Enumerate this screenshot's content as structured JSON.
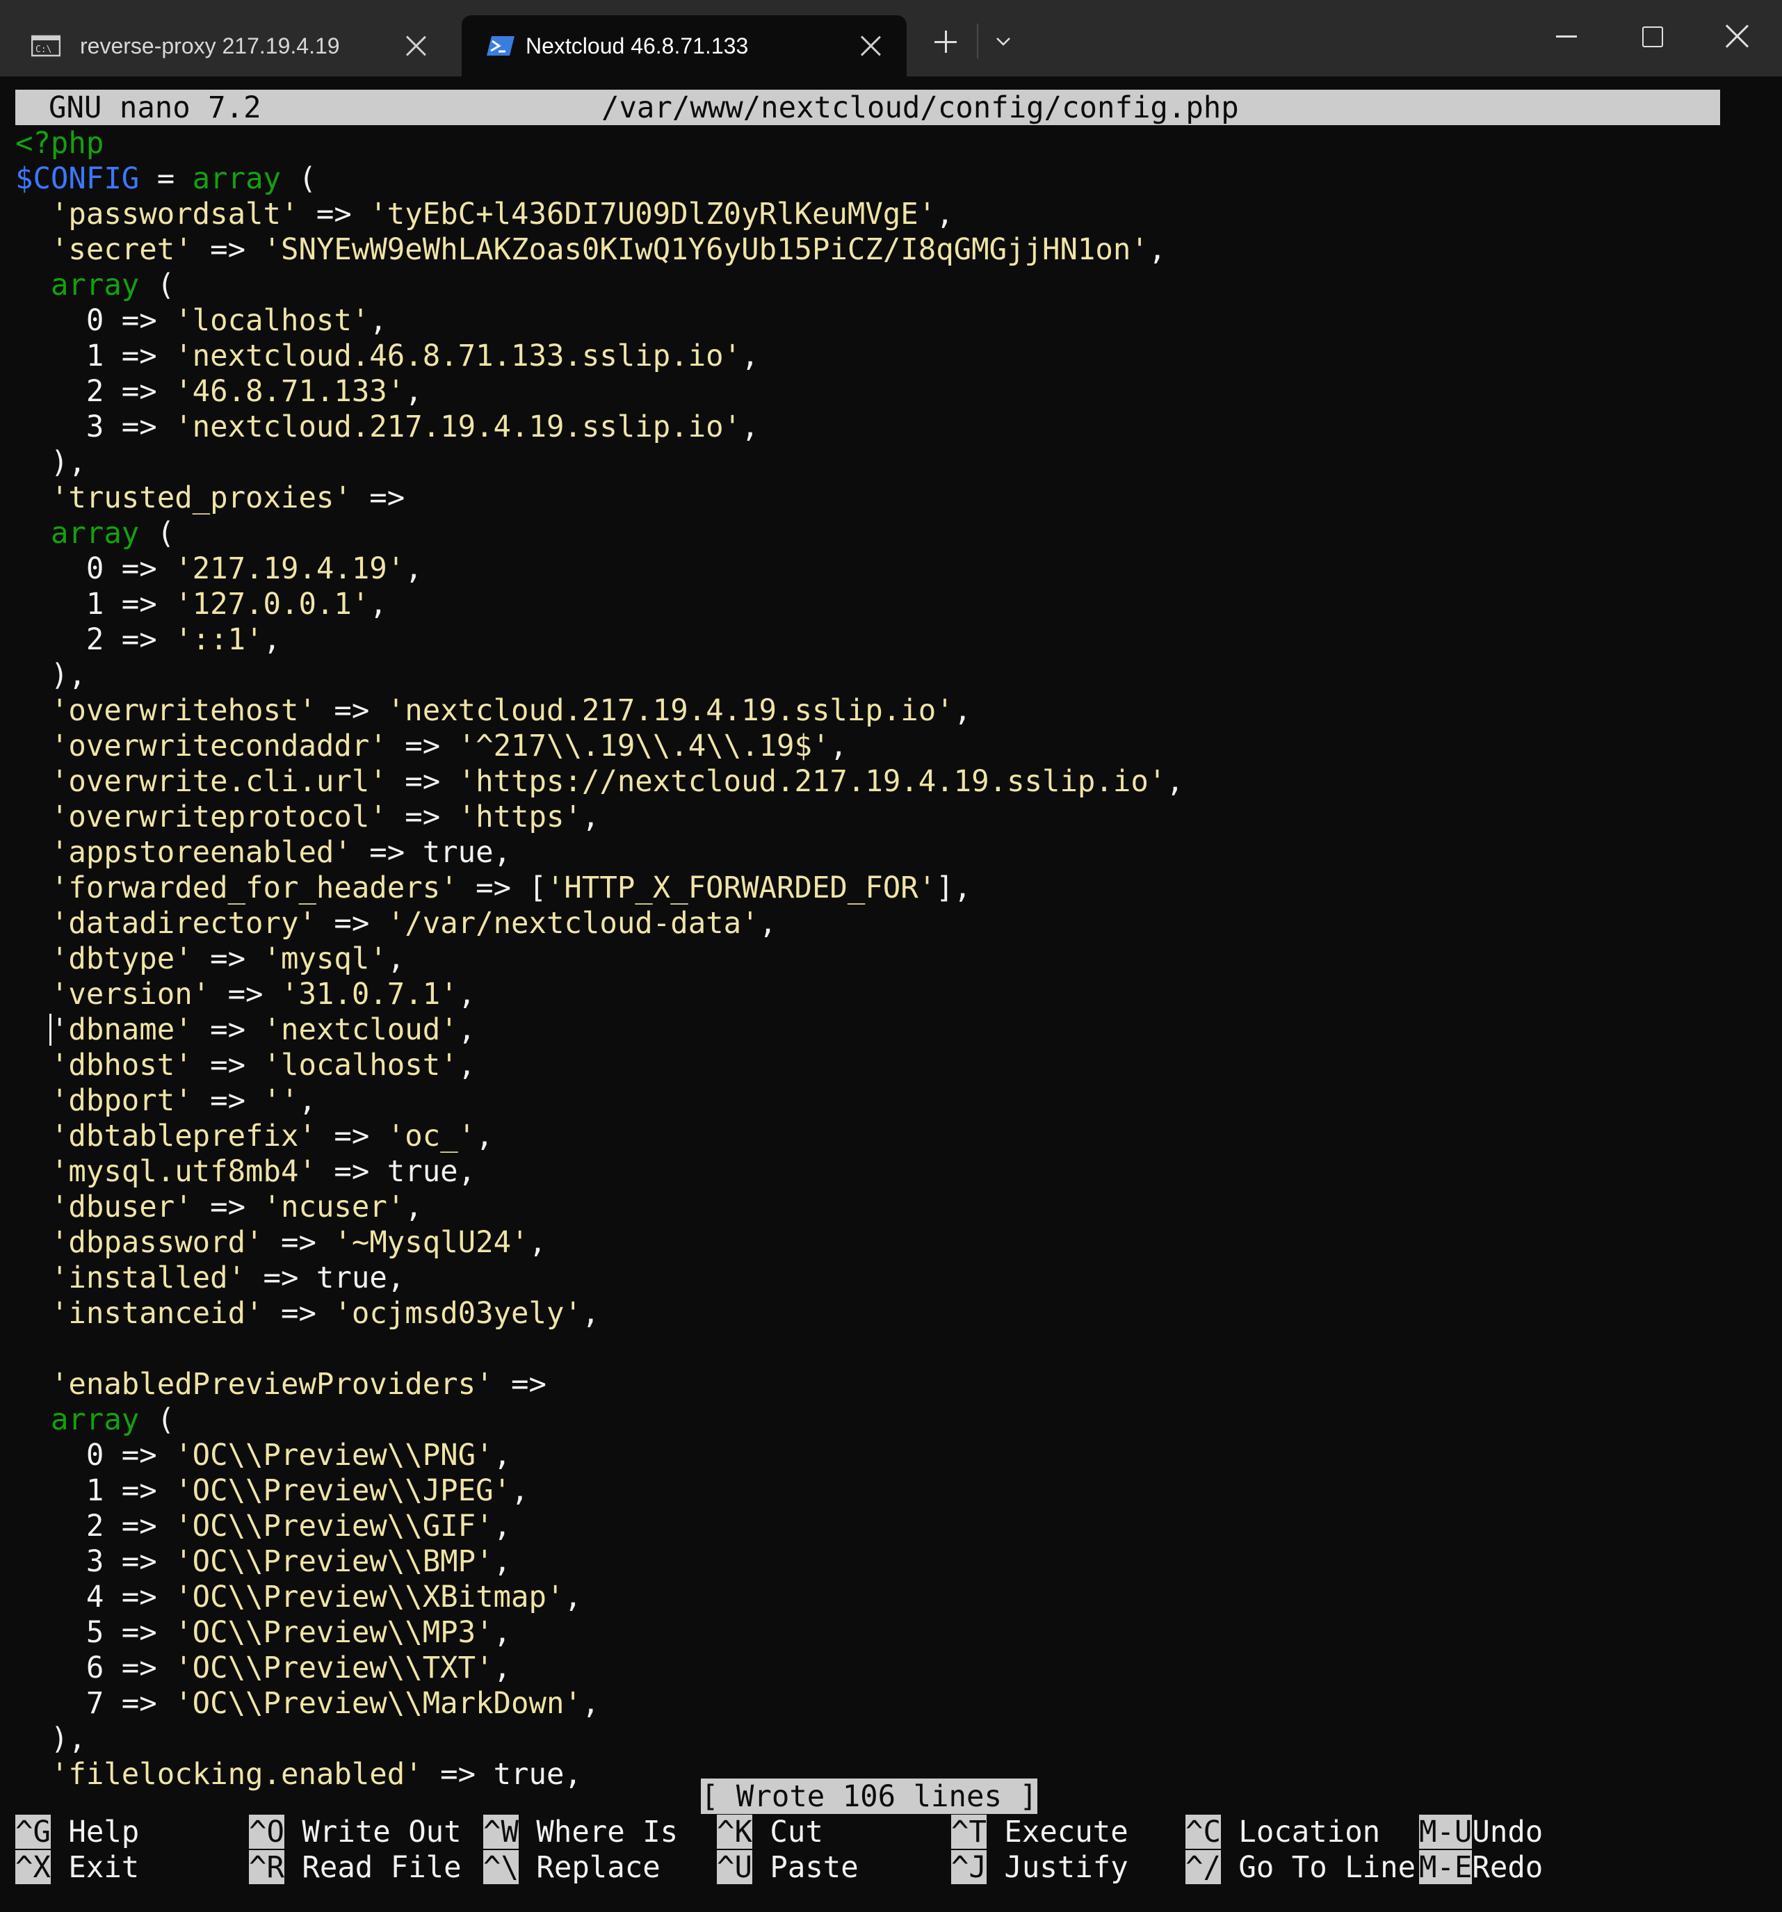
{
  "window": {
    "tabs": [
      {
        "title": "reverse-proxy 217.19.4.19",
        "icon": "cmd-icon",
        "active": false
      },
      {
        "title": "Nextcloud 46.8.71.133",
        "icon": "powershell-icon",
        "active": true
      }
    ]
  },
  "nano": {
    "version": "GNU nano 7.2",
    "filename": "/var/www/nextcloud/config/config.php",
    "status": "[ Wrote 106 lines ]",
    "lines": [
      [
        [
          "k",
          "<?php"
        ]
      ],
      [
        [
          "v",
          "$CONFIG"
        ],
        [
          "p",
          " = "
        ],
        [
          "k",
          "array"
        ],
        [
          "p",
          " ("
        ]
      ],
      [
        [
          "p",
          "  "
        ],
        [
          "s",
          "'passwordsalt'"
        ],
        [
          "p",
          " => "
        ],
        [
          "s",
          "'tyEbC+l436DI7U09DlZ0yRlKeuMVgE'"
        ],
        [
          "p",
          ","
        ]
      ],
      [
        [
          "p",
          "  "
        ],
        [
          "s",
          "'secret'"
        ],
        [
          "p",
          " => "
        ],
        [
          "s",
          "'SNYEwW9eWhLAKZoas0KIwQ1Y6yUb15PiCZ/I8qGMGjjHN1on'"
        ],
        [
          "p",
          ","
        ]
      ],
      [
        [
          "p",
          "  "
        ],
        [
          "k",
          "array"
        ],
        [
          "p",
          " ("
        ]
      ],
      [
        [
          "p",
          "    0 => "
        ],
        [
          "s",
          "'localhost'"
        ],
        [
          "p",
          ","
        ]
      ],
      [
        [
          "p",
          "    1 => "
        ],
        [
          "s",
          "'nextcloud.46.8.71.133.sslip.io'"
        ],
        [
          "p",
          ","
        ]
      ],
      [
        [
          "p",
          "    2 => "
        ],
        [
          "s",
          "'46.8.71.133'"
        ],
        [
          "p",
          ","
        ]
      ],
      [
        [
          "p",
          "    3 => "
        ],
        [
          "s",
          "'nextcloud.217.19.4.19.sslip.io'"
        ],
        [
          "p",
          ","
        ]
      ],
      [
        [
          "p",
          "  ),"
        ]
      ],
      [
        [
          "p",
          "  "
        ],
        [
          "s",
          "'trusted_proxies'"
        ],
        [
          "p",
          " =>"
        ]
      ],
      [
        [
          "p",
          "  "
        ],
        [
          "k",
          "array"
        ],
        [
          "p",
          " ("
        ]
      ],
      [
        [
          "p",
          "    0 => "
        ],
        [
          "s",
          "'217.19.4.19'"
        ],
        [
          "p",
          ","
        ]
      ],
      [
        [
          "p",
          "    1 => "
        ],
        [
          "s",
          "'127.0.0.1'"
        ],
        [
          "p",
          ","
        ]
      ],
      [
        [
          "p",
          "    2 => "
        ],
        [
          "s",
          "'::1'"
        ],
        [
          "p",
          ","
        ]
      ],
      [
        [
          "p",
          "  ),"
        ]
      ],
      [
        [
          "p",
          "  "
        ],
        [
          "s",
          "'overwritehost'"
        ],
        [
          "p",
          " => "
        ],
        [
          "s",
          "'nextcloud.217.19.4.19.sslip.io'"
        ],
        [
          "p",
          ","
        ]
      ],
      [
        [
          "p",
          "  "
        ],
        [
          "s",
          "'overwritecondaddr'"
        ],
        [
          "p",
          " => "
        ],
        [
          "s",
          "'^217\\\\.19\\\\.4\\\\.19$'"
        ],
        [
          "p",
          ","
        ]
      ],
      [
        [
          "p",
          "  "
        ],
        [
          "s",
          "'overwrite.cli.url'"
        ],
        [
          "p",
          " => "
        ],
        [
          "s",
          "'https://nextcloud.217.19.4.19.sslip.io'"
        ],
        [
          "p",
          ","
        ]
      ],
      [
        [
          "p",
          "  "
        ],
        [
          "s",
          "'overwriteprotocol'"
        ],
        [
          "p",
          " => "
        ],
        [
          "s",
          "'https'"
        ],
        [
          "p",
          ","
        ]
      ],
      [
        [
          "p",
          "  "
        ],
        [
          "s",
          "'appstoreenabled'"
        ],
        [
          "p",
          " => true,"
        ]
      ],
      [
        [
          "p",
          "  "
        ],
        [
          "s",
          "'forwarded_for_headers'"
        ],
        [
          "p",
          " => ["
        ],
        [
          "s",
          "'HTTP_X_FORWARDED_FOR'"
        ],
        [
          "p",
          "],"
        ]
      ],
      [
        [
          "p",
          "  "
        ],
        [
          "s",
          "'datadirectory'"
        ],
        [
          "p",
          " => "
        ],
        [
          "s",
          "'/var/nextcloud-data'"
        ],
        [
          "p",
          ","
        ]
      ],
      [
        [
          "p",
          "  "
        ],
        [
          "s",
          "'dbtype'"
        ],
        [
          "p",
          " => "
        ],
        [
          "s",
          "'mysql'"
        ],
        [
          "p",
          ","
        ]
      ],
      [
        [
          "p",
          "  "
        ],
        [
          "s",
          "'version'"
        ],
        [
          "p",
          " => "
        ],
        [
          "s",
          "'31.0.7.1'"
        ],
        [
          "p",
          ","
        ]
      ],
      [
        [
          "p",
          "  "
        ],
        [
          "c",
          "'"
        ],
        [
          "s",
          "dbname'"
        ],
        [
          "p",
          " => "
        ],
        [
          "s",
          "'nextcloud'"
        ],
        [
          "p",
          ","
        ]
      ],
      [
        [
          "p",
          "  "
        ],
        [
          "s",
          "'dbhost'"
        ],
        [
          "p",
          " => "
        ],
        [
          "s",
          "'localhost'"
        ],
        [
          "p",
          ","
        ]
      ],
      [
        [
          "p",
          "  "
        ],
        [
          "s",
          "'dbport'"
        ],
        [
          "p",
          " => "
        ],
        [
          "s",
          "''"
        ],
        [
          "p",
          ","
        ]
      ],
      [
        [
          "p",
          "  "
        ],
        [
          "s",
          "'dbtableprefix'"
        ],
        [
          "p",
          " => "
        ],
        [
          "s",
          "'oc_'"
        ],
        [
          "p",
          ","
        ]
      ],
      [
        [
          "p",
          "  "
        ],
        [
          "s",
          "'mysql.utf8mb4'"
        ],
        [
          "p",
          " => true,"
        ]
      ],
      [
        [
          "p",
          "  "
        ],
        [
          "s",
          "'dbuser'"
        ],
        [
          "p",
          " => "
        ],
        [
          "s",
          "'ncuser'"
        ],
        [
          "p",
          ","
        ]
      ],
      [
        [
          "p",
          "  "
        ],
        [
          "s",
          "'dbpassword'"
        ],
        [
          "p",
          " => "
        ],
        [
          "s",
          "'~MysqlU24'"
        ],
        [
          "p",
          ","
        ]
      ],
      [
        [
          "p",
          "  "
        ],
        [
          "s",
          "'installed'"
        ],
        [
          "p",
          " => true,"
        ]
      ],
      [
        [
          "p",
          "  "
        ],
        [
          "s",
          "'instanceid'"
        ],
        [
          "p",
          " => "
        ],
        [
          "s",
          "'ocjmsd03yely'"
        ],
        [
          "p",
          ","
        ]
      ],
      [
        [
          "p",
          ""
        ]
      ],
      [
        [
          "p",
          "  "
        ],
        [
          "s",
          "'enabledPreviewProviders'"
        ],
        [
          "p",
          " =>"
        ]
      ],
      [
        [
          "p",
          "  "
        ],
        [
          "k",
          "array"
        ],
        [
          "p",
          " ("
        ]
      ],
      [
        [
          "p",
          "    0 => "
        ],
        [
          "s",
          "'OC\\\\Preview\\\\PNG'"
        ],
        [
          "p",
          ","
        ]
      ],
      [
        [
          "p",
          "    1 => "
        ],
        [
          "s",
          "'OC\\\\Preview\\\\JPEG'"
        ],
        [
          "p",
          ","
        ]
      ],
      [
        [
          "p",
          "    2 => "
        ],
        [
          "s",
          "'OC\\\\Preview\\\\GIF'"
        ],
        [
          "p",
          ","
        ]
      ],
      [
        [
          "p",
          "    3 => "
        ],
        [
          "s",
          "'OC\\\\Preview\\\\BMP'"
        ],
        [
          "p",
          ","
        ]
      ],
      [
        [
          "p",
          "    4 => "
        ],
        [
          "s",
          "'OC\\\\Preview\\\\XBitmap'"
        ],
        [
          "p",
          ","
        ]
      ],
      [
        [
          "p",
          "    5 => "
        ],
        [
          "s",
          "'OC\\\\Preview\\\\MP3'"
        ],
        [
          "p",
          ","
        ]
      ],
      [
        [
          "p",
          "    6 => "
        ],
        [
          "s",
          "'OC\\\\Preview\\\\TXT'"
        ],
        [
          "p",
          ","
        ]
      ],
      [
        [
          "p",
          "    7 => "
        ],
        [
          "s",
          "'OC\\\\Preview\\\\MarkDown'"
        ],
        [
          "p",
          ","
        ]
      ],
      [
        [
          "p",
          "  ),"
        ]
      ],
      [
        [
          "p",
          "  "
        ],
        [
          "s",
          "'filelocking.enabled'"
        ],
        [
          "p",
          " => true,"
        ]
      ]
    ],
    "shortcuts": [
      {
        "key": "^G",
        "label": "Help",
        "name": "shortcut-help"
      },
      {
        "key": "^X",
        "label": "Exit",
        "name": "shortcut-exit"
      },
      {
        "key": "^O",
        "label": "Write Out",
        "name": "shortcut-write-out"
      },
      {
        "key": "^R",
        "label": "Read File",
        "name": "shortcut-read-file"
      },
      {
        "key": "^W",
        "label": "Where Is",
        "name": "shortcut-where-is"
      },
      {
        "key": "^\\",
        "label": "Replace",
        "name": "shortcut-replace"
      },
      {
        "key": "^K",
        "label": "Cut",
        "name": "shortcut-cut"
      },
      {
        "key": "^U",
        "label": "Paste",
        "name": "shortcut-paste"
      },
      {
        "key": "^T",
        "label": "Execute",
        "name": "shortcut-execute"
      },
      {
        "key": "^J",
        "label": "Justify",
        "name": "shortcut-justify"
      },
      {
        "key": "^C",
        "label": "Location",
        "name": "shortcut-location"
      },
      {
        "key": "^/",
        "label": "Go To Line",
        "name": "shortcut-go-to-line"
      },
      {
        "key": "M-U",
        "label": "Undo",
        "name": "shortcut-undo"
      },
      {
        "key": "M-E",
        "label": "Redo",
        "name": "shortcut-redo"
      }
    ]
  },
  "colors": {
    "terminal_bg": "#0c0c0c",
    "text": "#f2f2f2",
    "string": "#f0e4a6",
    "keyword": "#13a10e",
    "variable": "#3b78ff",
    "bar": "#cccccc",
    "titlebar": "#2b2b2b"
  }
}
